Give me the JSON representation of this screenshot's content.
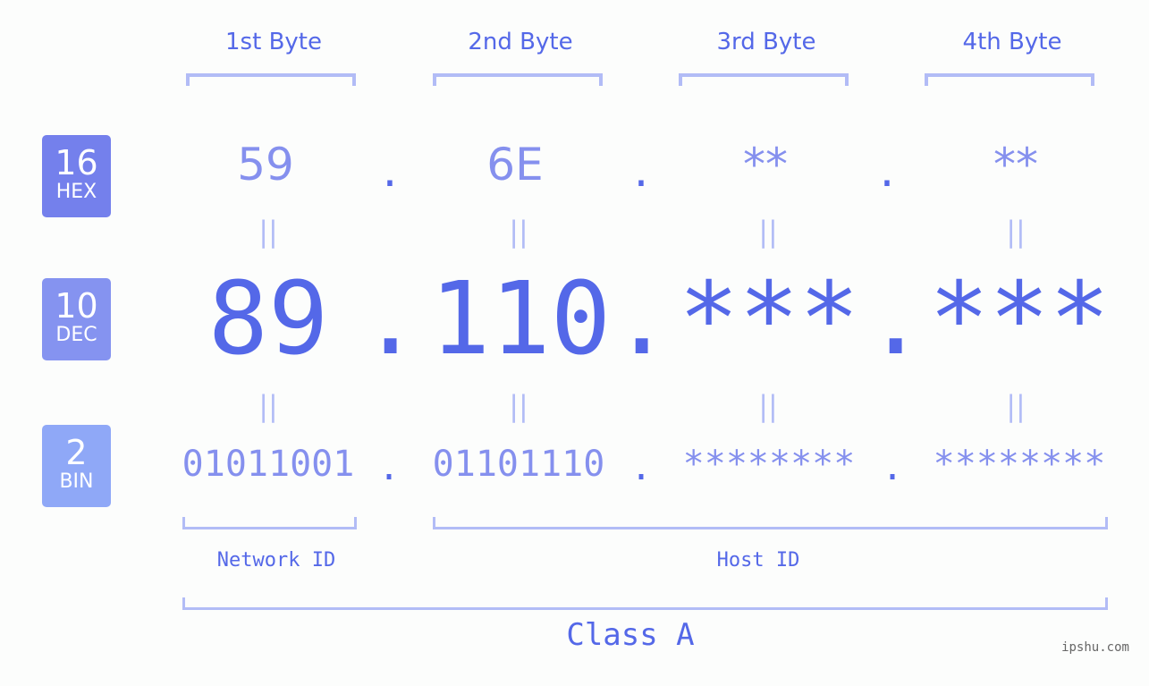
{
  "byte_headers": [
    "1st Byte",
    "2nd Byte",
    "3rd Byte",
    "4th Byte"
  ],
  "badges": [
    {
      "number": "16",
      "unit": "HEX",
      "color": "#7480ec"
    },
    {
      "number": "10",
      "unit": "DEC",
      "color": "#8593f0"
    },
    {
      "number": "2",
      "unit": "BIN",
      "color": "#8fa8f7"
    }
  ],
  "hex_octets": [
    "59",
    "6E",
    "**",
    "**"
  ],
  "dec_octets": [
    "89",
    "110",
    "***",
    "***"
  ],
  "bin_octets": [
    "01011001",
    "01101110",
    "********",
    "********"
  ],
  "separator": ".",
  "equals_glyph": "||",
  "network_label": "Network ID",
  "host_label": "Host ID",
  "class_label": "Class A",
  "watermark": "ipshu.com",
  "colors": {
    "primary": "#5468e8",
    "secondary": "#8590ee",
    "bracket": "#b2bcf6",
    "background": "#fcfdfc"
  }
}
